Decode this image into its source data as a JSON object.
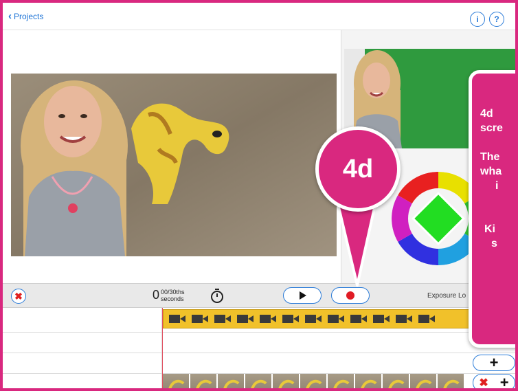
{
  "nav": {
    "back_label": "Projects",
    "info_label": "i",
    "help_label": "?"
  },
  "controls": {
    "time_value": "0",
    "time_frac": "00/30ths",
    "time_unit": "seconds",
    "exposure_label": "Exposure Lo"
  },
  "callout": {
    "bubble_label": "4d",
    "card_lines": [
      "4d",
      "scre",
      "The",
      "wha",
      "i",
      "Ki",
      "s"
    ]
  },
  "icons": {
    "play": "play-icon",
    "record": "record-icon",
    "timer": "stopwatch-icon",
    "delete": "close-icon",
    "add": "plus-icon"
  },
  "colors": {
    "accent_blue": "#2a7bd8",
    "callout_pink": "#d9287f",
    "record_red": "#e01b24",
    "film_yellow": "#f1c12a",
    "green_screen": "#2f9a3e"
  }
}
